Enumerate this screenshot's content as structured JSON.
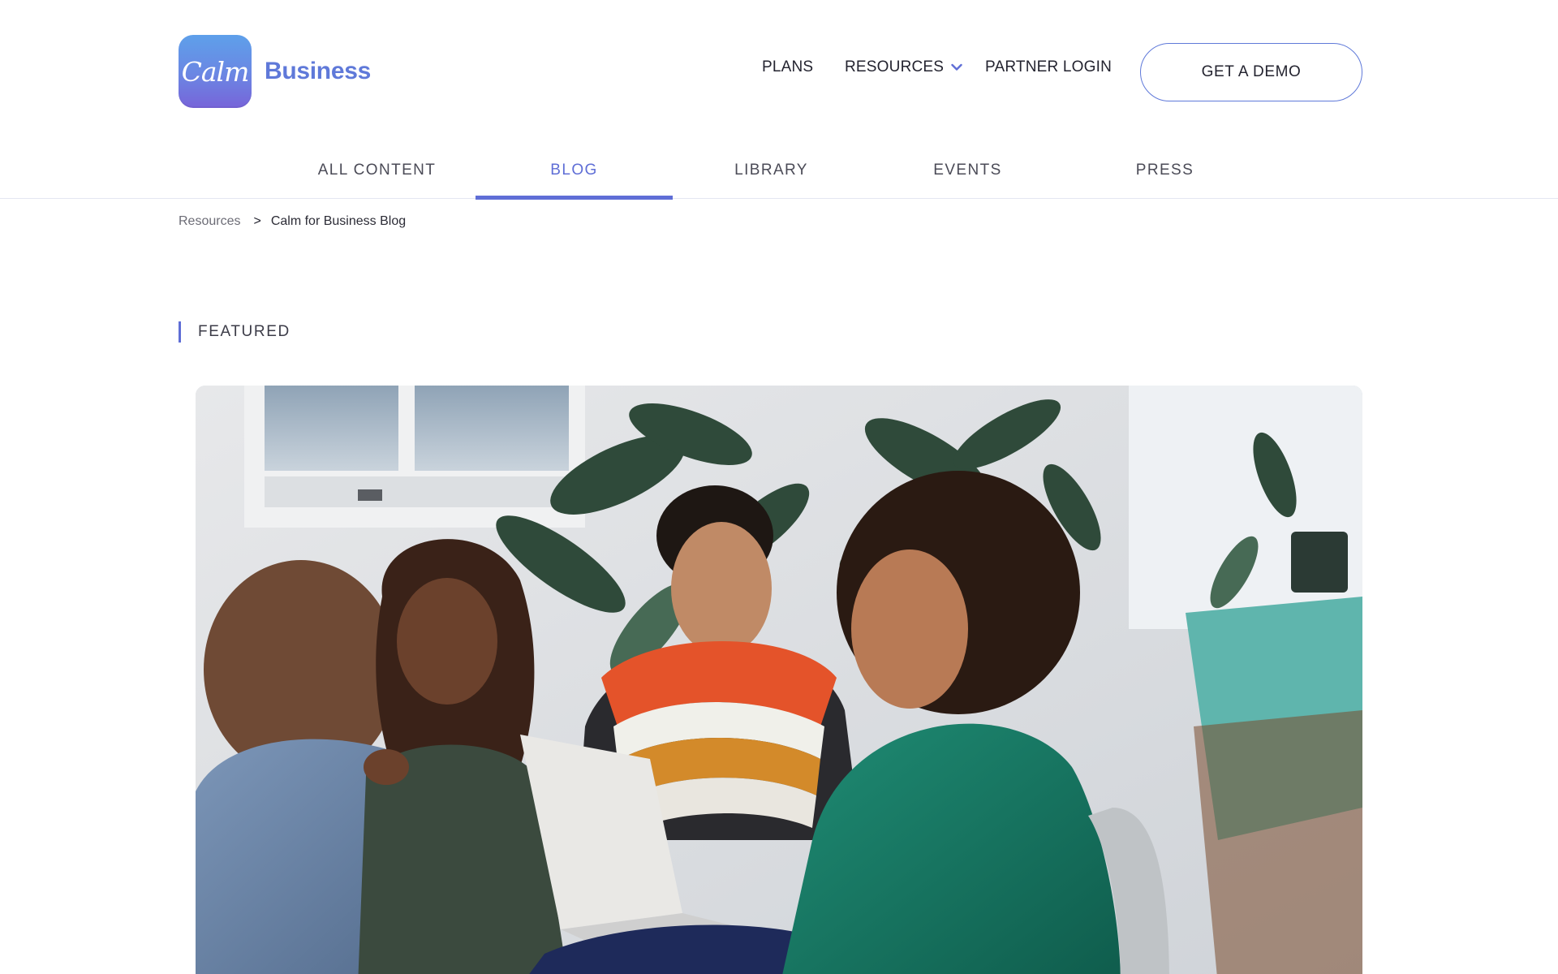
{
  "brand": {
    "logo_mark_text": "Calm",
    "logo_word": "Business",
    "accent": "#5f6ed6",
    "brand_blue": "#5f79d9"
  },
  "topnav": {
    "items": [
      {
        "label": "PLANS"
      },
      {
        "label": "RESOURCES",
        "icon": "chevron-down-icon"
      },
      {
        "label": "PARTNER LOGIN"
      }
    ],
    "cta": "GET A DEMO"
  },
  "subnav": {
    "tabs": [
      {
        "label": "ALL CONTENT",
        "active": false
      },
      {
        "label": "BLOG",
        "active": true
      },
      {
        "label": "LIBRARY",
        "active": false
      },
      {
        "label": "EVENTS",
        "active": false
      },
      {
        "label": "PRESS",
        "active": false
      }
    ]
  },
  "breadcrumb": {
    "parent": "Resources",
    "separator": ">",
    "current": "Calm for Business Blog"
  },
  "featured": {
    "label": "FEATURED"
  }
}
